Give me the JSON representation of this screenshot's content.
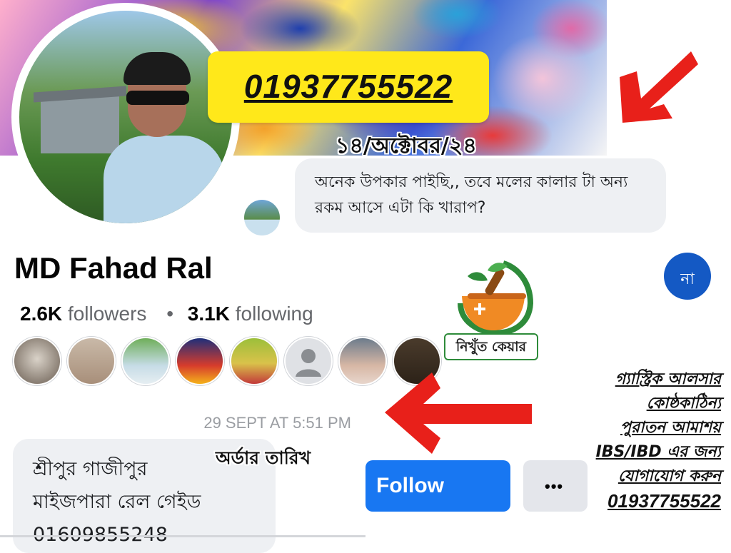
{
  "overlay": {
    "phone": "01937755522",
    "comment_date": "১৪/অক্টোবর/২৪",
    "order_date_label": "অর্ডার তারিখ"
  },
  "comment": {
    "text": "অনেক উপকার পাইছি,, তবে মলের কালার টা অন্য রকম আসে এটা কি খারাপ?"
  },
  "profile": {
    "name": "MD Fahad Ral",
    "followers_count": "2.6K",
    "followers_label": "followers",
    "following_count": "3.1K",
    "following_label": "following",
    "separator": "•",
    "friends_count_visible": 8
  },
  "message": {
    "timestamp": "29 SEPT AT 5:51 PM",
    "address_line1": "শ্রীপুর গাজীপুর",
    "address_line2": "মাইজপারা রেল গেইড",
    "address_line3": "01609855248"
  },
  "buttons": {
    "follow": "Follow",
    "more": "•••",
    "na": "না"
  },
  "brand": {
    "name": "নিখুঁত কেয়ার"
  },
  "ad": {
    "lines": [
      "গ্যাস্ট্রিক আলসার",
      "কোষ্ঠকাঠিন্য",
      "পুরাতন আমাশয়",
      "IBS/IBD এর জন্য",
      "যোগাযোগ করুন",
      "01937755522"
    ]
  },
  "colors": {
    "accent_blue": "#1877f2",
    "highlight_yellow": "#ffe81a",
    "arrow_red": "#e8201a",
    "brand_green": "#2e8b3a",
    "brand_orange": "#f08a24"
  }
}
